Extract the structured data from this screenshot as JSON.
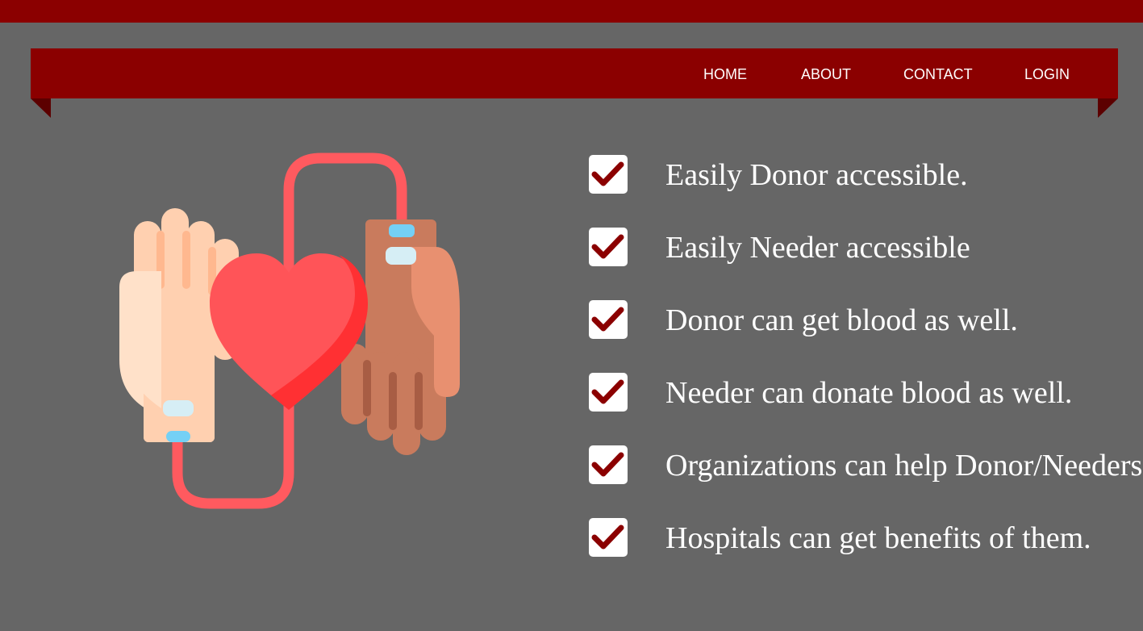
{
  "colors": {
    "page_background": "#666666",
    "brand_dark_red": "#8b0000",
    "text_white": "#ffffff"
  },
  "nav": {
    "items": [
      {
        "label": "HOME"
      },
      {
        "label": "ABOUT"
      },
      {
        "label": "CONTACT"
      },
      {
        "label": "LOGIN"
      }
    ]
  },
  "hero": {
    "illustration": "blood-donation-hands-heart-icon"
  },
  "features": {
    "icon": "checkbox-checked-icon",
    "items": [
      {
        "text": "Easily Donor accessible."
      },
      {
        "text": "Easily Needer accessible"
      },
      {
        "text": "Donor can get blood as well."
      },
      {
        "text": "Needer can donate blood as well."
      },
      {
        "text": "Organizations can help Donor/Needers."
      },
      {
        "text": "Hospitals can get benefits of them."
      }
    ]
  }
}
